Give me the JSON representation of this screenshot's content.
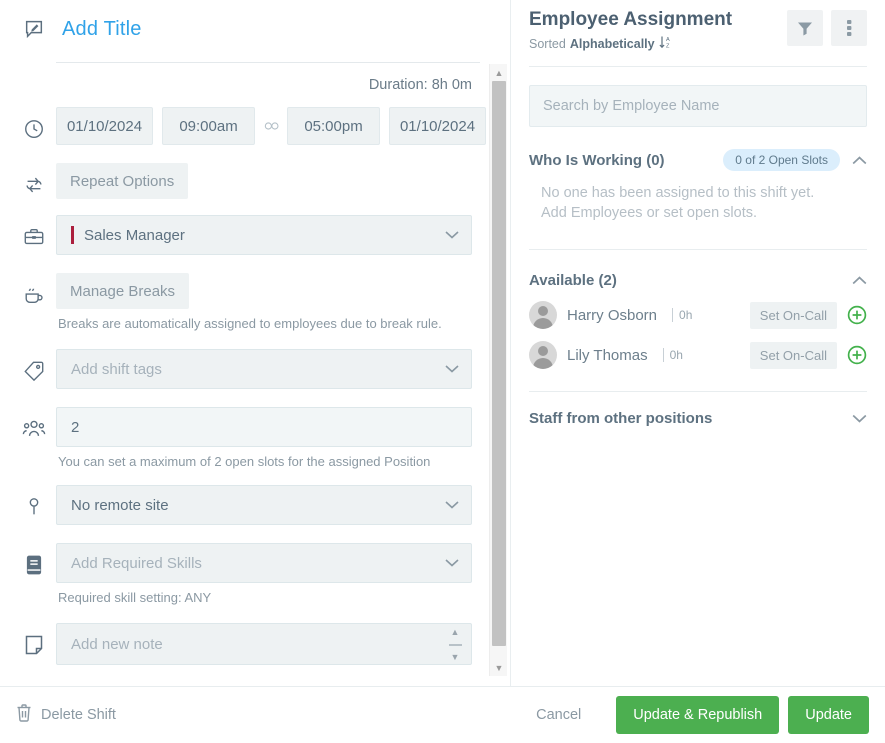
{
  "shift_form": {
    "title_placeholder": "Add Title",
    "duration_label": "Duration: 8h 0m",
    "start_date": "01/10/2024",
    "start_time": "09:00am",
    "end_time": "05:00pm",
    "end_date": "01/10/2024",
    "repeat_options_label": "Repeat Options",
    "position_value": "Sales Manager",
    "manage_breaks_label": "Manage Breaks",
    "breaks_helper": "Breaks are automatically assigned to employees due to break rule.",
    "shift_tags_placeholder": "Add shift tags",
    "open_slots_value": "2",
    "open_slots_helper": "You can set a maximum of 2 open slots for the assigned Position",
    "remote_site_value": "No remote site",
    "required_skills_placeholder": "Add Required Skills",
    "required_skills_helper": "Required skill setting: ANY",
    "note_placeholder": "Add new note"
  },
  "assignment": {
    "title": "Employee Assignment",
    "sorted_prefix": "Sorted",
    "sorted_value": "Alphabetically",
    "search_placeholder": "Search by Employee Name",
    "who_is_working": {
      "label": "Who Is Working (0)",
      "badge": "0 of 2 Open Slots",
      "empty_message": "No one has been assigned to this shift yet. Add Employees or set open slots."
    },
    "available": {
      "label": "Available (2)",
      "employees": [
        {
          "name": "Harry Osborn",
          "hours": "0h",
          "oncall_label": "Set On-Call"
        },
        {
          "name": "Lily Thomas",
          "hours": "0h",
          "oncall_label": "Set On-Call"
        }
      ]
    },
    "other_positions": {
      "label": "Staff from other positions"
    }
  },
  "footer": {
    "delete_label": "Delete Shift",
    "cancel_label": "Cancel",
    "update_republish_label": "Update & Republish",
    "update_label": "Update"
  },
  "colors": {
    "accent_link": "#30a2e8",
    "primary_green": "#4caf50",
    "badge_bg": "#dbeefc",
    "position_marker": "#ab1f3d",
    "plus_green": "#42b14b"
  }
}
